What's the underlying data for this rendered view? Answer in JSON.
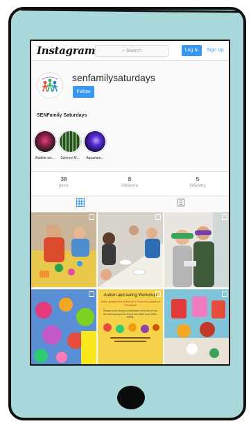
{
  "header": {
    "logo": "Instagram",
    "search_placeholder": "Search",
    "login_label": "Log In",
    "signup_label": "Sign Up"
  },
  "profile": {
    "username": "senfamilysaturdays",
    "follow_label": "Follow",
    "full_name": "SENFamily Saturdays"
  },
  "highlights": [
    {
      "label": "Bubble wo..."
    },
    {
      "label": "Science M..."
    },
    {
      "label": "Aquarium..."
    }
  ],
  "stats": [
    {
      "number": "38",
      "label": "posts"
    },
    {
      "number": "8",
      "label": "followers"
    },
    {
      "number": "5",
      "label": "following"
    }
  ],
  "posts": [
    {
      "type": "photo"
    },
    {
      "type": "photo"
    },
    {
      "type": "photo"
    },
    {
      "type": "photo"
    },
    {
      "type": "poster",
      "title": "Autism and eating Workshop",
      "subtitle": "Isaac speaks first Aufeld (For Your Occupational Therapist)",
      "body": "Please come along to understand more about how the sensory aspects of food can affect your child's eating."
    },
    {
      "type": "photo"
    }
  ],
  "colors": {
    "accent_blue": "#3897f0",
    "phone_body": "#a9d8da",
    "poster_yellow": "#f6d24b"
  },
  "icons": [
    "search-icon",
    "grid-icon",
    "tagged-icon",
    "multi-photo-icon"
  ]
}
